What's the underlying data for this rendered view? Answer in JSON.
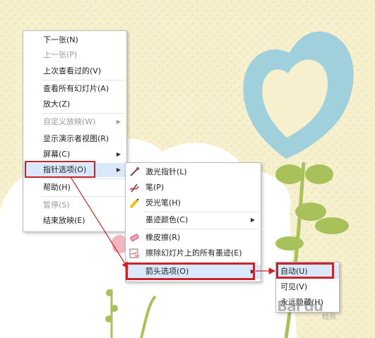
{
  "main_menu": {
    "items": [
      {
        "label": "下一张(N)",
        "disabled": false
      },
      {
        "label": "上一张(P)",
        "disabled": true
      },
      {
        "label": "上次查看过的(V)",
        "disabled": false
      },
      {
        "label": "查看所有幻灯片(A)",
        "disabled": false
      },
      {
        "label": "放大(Z)",
        "disabled": false
      },
      {
        "label": "自定义放映(W)",
        "disabled": true,
        "submenu": true
      },
      {
        "label": "显示演示者视图(R)",
        "disabled": false
      },
      {
        "label": "屏幕(C)",
        "disabled": false,
        "submenu": true
      },
      {
        "label": "指针选项(O)",
        "disabled": false,
        "submenu": true,
        "highlighted": true
      },
      {
        "label": "帮助(H)",
        "disabled": false
      },
      {
        "label": "暂停(S)",
        "disabled": true
      },
      {
        "label": "结束放映(E)",
        "disabled": false
      }
    ]
  },
  "pointer_menu": {
    "items": [
      {
        "label": "激光指针(L)",
        "icon": "laser-pointer-icon"
      },
      {
        "label": "笔(P)",
        "icon": "pen-icon"
      },
      {
        "label": "荧光笔(H)",
        "icon": "highlighter-icon"
      },
      {
        "label": "墨迹颜色(C)",
        "submenu": true
      },
      {
        "label": "橡皮擦(R)",
        "icon": "eraser-icon"
      },
      {
        "label": "擦除幻灯片上的所有墨迹(E)",
        "icon": "erase-all-ink-icon"
      },
      {
        "label": "箭头选项(O)",
        "submenu": true,
        "highlighted": true
      }
    ]
  },
  "arrow_menu": {
    "items": [
      {
        "label": "自动(U)",
        "highlighted": true
      },
      {
        "label": "可见(V)"
      },
      {
        "label": "永远隐藏(H)"
      }
    ]
  },
  "watermark": {
    "text": "Bai du",
    "sub": "经验"
  },
  "colors": {
    "annotation_red": "#c9242b",
    "highlight": "#d9e9fb",
    "background": "#f6f0cf"
  }
}
